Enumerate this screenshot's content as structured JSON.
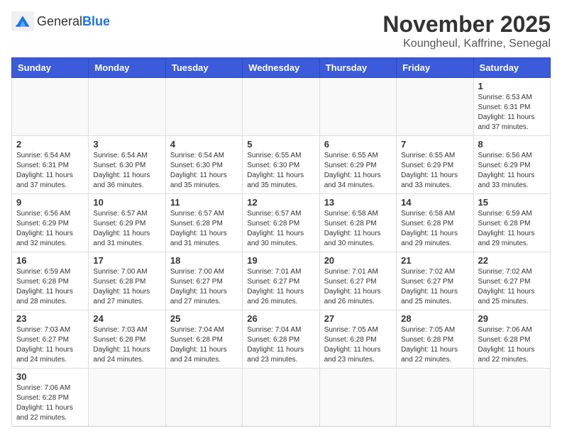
{
  "header": {
    "logo_general": "General",
    "logo_blue": "Blue",
    "month_year": "November 2025",
    "location": "Koungheul, Kaffrine, Senegal"
  },
  "weekdays": [
    "Sunday",
    "Monday",
    "Tuesday",
    "Wednesday",
    "Thursday",
    "Friday",
    "Saturday"
  ],
  "weeks": [
    [
      {
        "day": "",
        "info": ""
      },
      {
        "day": "",
        "info": ""
      },
      {
        "day": "",
        "info": ""
      },
      {
        "day": "",
        "info": ""
      },
      {
        "day": "",
        "info": ""
      },
      {
        "day": "",
        "info": ""
      },
      {
        "day": "1",
        "info": "Sunrise: 6:53 AM\nSunset: 6:31 PM\nDaylight: 11 hours and 37 minutes."
      }
    ],
    [
      {
        "day": "2",
        "info": "Sunrise: 6:54 AM\nSunset: 6:31 PM\nDaylight: 11 hours and 37 minutes."
      },
      {
        "day": "3",
        "info": "Sunrise: 6:54 AM\nSunset: 6:30 PM\nDaylight: 11 hours and 36 minutes."
      },
      {
        "day": "4",
        "info": "Sunrise: 6:54 AM\nSunset: 6:30 PM\nDaylight: 11 hours and 35 minutes."
      },
      {
        "day": "5",
        "info": "Sunrise: 6:55 AM\nSunset: 6:30 PM\nDaylight: 11 hours and 35 minutes."
      },
      {
        "day": "6",
        "info": "Sunrise: 6:55 AM\nSunset: 6:29 PM\nDaylight: 11 hours and 34 minutes."
      },
      {
        "day": "7",
        "info": "Sunrise: 6:55 AM\nSunset: 6:29 PM\nDaylight: 11 hours and 33 minutes."
      },
      {
        "day": "8",
        "info": "Sunrise: 6:56 AM\nSunset: 6:29 PM\nDaylight: 11 hours and 33 minutes."
      }
    ],
    [
      {
        "day": "9",
        "info": "Sunrise: 6:56 AM\nSunset: 6:29 PM\nDaylight: 11 hours and 32 minutes."
      },
      {
        "day": "10",
        "info": "Sunrise: 6:57 AM\nSunset: 6:29 PM\nDaylight: 11 hours and 31 minutes."
      },
      {
        "day": "11",
        "info": "Sunrise: 6:57 AM\nSunset: 6:28 PM\nDaylight: 11 hours and 31 minutes."
      },
      {
        "day": "12",
        "info": "Sunrise: 6:57 AM\nSunset: 6:28 PM\nDaylight: 11 hours and 30 minutes."
      },
      {
        "day": "13",
        "info": "Sunrise: 6:58 AM\nSunset: 6:28 PM\nDaylight: 11 hours and 30 minutes."
      },
      {
        "day": "14",
        "info": "Sunrise: 6:58 AM\nSunset: 6:28 PM\nDaylight: 11 hours and 29 minutes."
      },
      {
        "day": "15",
        "info": "Sunrise: 6:59 AM\nSunset: 6:28 PM\nDaylight: 11 hours and 29 minutes."
      }
    ],
    [
      {
        "day": "16",
        "info": "Sunrise: 6:59 AM\nSunset: 6:28 PM\nDaylight: 11 hours and 28 minutes."
      },
      {
        "day": "17",
        "info": "Sunrise: 7:00 AM\nSunset: 6:28 PM\nDaylight: 11 hours and 27 minutes."
      },
      {
        "day": "18",
        "info": "Sunrise: 7:00 AM\nSunset: 6:27 PM\nDaylight: 11 hours and 27 minutes."
      },
      {
        "day": "19",
        "info": "Sunrise: 7:01 AM\nSunset: 6:27 PM\nDaylight: 11 hours and 26 minutes."
      },
      {
        "day": "20",
        "info": "Sunrise: 7:01 AM\nSunset: 6:27 PM\nDaylight: 11 hours and 26 minutes."
      },
      {
        "day": "21",
        "info": "Sunrise: 7:02 AM\nSunset: 6:27 PM\nDaylight: 11 hours and 25 minutes."
      },
      {
        "day": "22",
        "info": "Sunrise: 7:02 AM\nSunset: 6:27 PM\nDaylight: 11 hours and 25 minutes."
      }
    ],
    [
      {
        "day": "23",
        "info": "Sunrise: 7:03 AM\nSunset: 6:27 PM\nDaylight: 11 hours and 24 minutes."
      },
      {
        "day": "24",
        "info": "Sunrise: 7:03 AM\nSunset: 6:28 PM\nDaylight: 11 hours and 24 minutes."
      },
      {
        "day": "25",
        "info": "Sunrise: 7:04 AM\nSunset: 6:28 PM\nDaylight: 11 hours and 24 minutes."
      },
      {
        "day": "26",
        "info": "Sunrise: 7:04 AM\nSunset: 6:28 PM\nDaylight: 11 hours and 23 minutes."
      },
      {
        "day": "27",
        "info": "Sunrise: 7:05 AM\nSunset: 6:28 PM\nDaylight: 11 hours and 23 minutes."
      },
      {
        "day": "28",
        "info": "Sunrise: 7:05 AM\nSunset: 6:28 PM\nDaylight: 11 hours and 22 minutes."
      },
      {
        "day": "29",
        "info": "Sunrise: 7:06 AM\nSunset: 6:28 PM\nDaylight: 11 hours and 22 minutes."
      }
    ],
    [
      {
        "day": "30",
        "info": "Sunrise: 7:06 AM\nSunset: 6:28 PM\nDaylight: 11 hours and 22 minutes."
      },
      {
        "day": "",
        "info": ""
      },
      {
        "day": "",
        "info": ""
      },
      {
        "day": "",
        "info": ""
      },
      {
        "day": "",
        "info": ""
      },
      {
        "day": "",
        "info": ""
      },
      {
        "day": "",
        "info": ""
      }
    ]
  ]
}
